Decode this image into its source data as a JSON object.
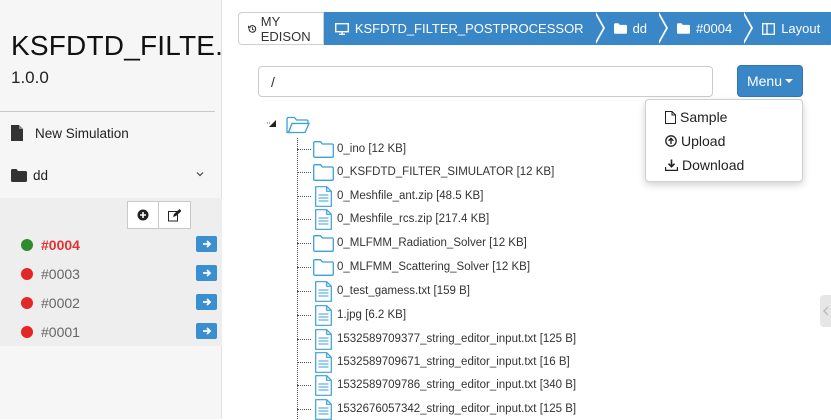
{
  "app": {
    "title": "KSFDTD_FILTE..",
    "version": "1.0.0"
  },
  "sidebar": {
    "new_simulation": "New Simulation",
    "folder": "dd",
    "jobs": [
      {
        "label": "#0004",
        "status_color": "#2e8b2e",
        "active": true
      },
      {
        "label": "#0003",
        "status_color": "#e32626",
        "active": false
      },
      {
        "label": "#0002",
        "status_color": "#e32626",
        "active": false
      },
      {
        "label": "#0001",
        "status_color": "#e32626",
        "active": false
      }
    ]
  },
  "breadcrumb": {
    "home": "MY EDISON",
    "items": [
      "KSFDTD_FILTER_POSTPROCESSOR",
      "dd",
      "#0004",
      "Layout"
    ]
  },
  "path": {
    "value": "/"
  },
  "menu": {
    "label": "Menu",
    "items": [
      "Sample",
      "Upload",
      "Download"
    ]
  },
  "tree": {
    "items": [
      {
        "name": "0_ino [12 KB]",
        "type": "folder"
      },
      {
        "name": "0_KSFDTD_FILTER_SIMULATOR [12 KB]",
        "type": "folder"
      },
      {
        "name": "0_Meshfile_ant.zip [48.5 KB]",
        "type": "file"
      },
      {
        "name": "0_Meshfile_rcs.zip [217.4 KB]",
        "type": "file"
      },
      {
        "name": "0_MLFMM_Radiation_Solver [12 KB]",
        "type": "folder"
      },
      {
        "name": "0_MLFMM_Scattering_Solver [12 KB]",
        "type": "folder"
      },
      {
        "name": "0_test_gamess.txt [159 B]",
        "type": "file"
      },
      {
        "name": "1.jpg [6.2 KB]",
        "type": "file"
      },
      {
        "name": "1532589709377_string_editor_input.txt [125 B]",
        "type": "file"
      },
      {
        "name": "1532589709671_string_editor_input.txt [16 B]",
        "type": "file"
      },
      {
        "name": "1532589709786_string_editor_input.txt [340 B]",
        "type": "file"
      },
      {
        "name": "1532676057342_string_editor_input.txt [125 B]",
        "type": "file"
      }
    ]
  },
  "colors": {
    "accent": "#3a87c8",
    "active_job": "#e03434"
  }
}
